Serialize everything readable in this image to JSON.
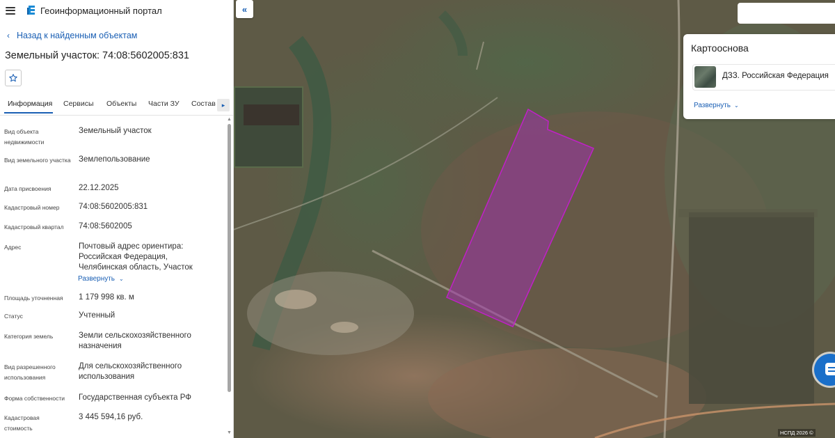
{
  "header": {
    "title": "Геоинформационный портал"
  },
  "nav": {
    "back_label": "Назад к найденным объектам"
  },
  "object": {
    "title": "Земельный участок: 74:08:5602005:831"
  },
  "tabs": [
    {
      "label": "Информация",
      "active": true
    },
    {
      "label": "Сервисы"
    },
    {
      "label": "Объекты"
    },
    {
      "label": "Части ЗУ"
    },
    {
      "label": "Состав"
    }
  ],
  "fields": [
    {
      "label": "Вид объекта недвижимости",
      "value": "Земельный участок"
    },
    {
      "label": "Вид земельного участка",
      "value": "Землепользование"
    },
    {
      "label": "Дата присвоения",
      "value": "22.12.2025"
    },
    {
      "label": "Кадастровый номер",
      "value": "74:08:5602005:831"
    },
    {
      "label": "Кадастровый квартал",
      "value": "74:08:5602005"
    },
    {
      "label": "Адрес",
      "value": "Почтовый адрес ориентира: Российская Федерация, Челябинская область, Участок"
    },
    {
      "label": "Площадь уточненная",
      "value": "1 179 998 кв. м"
    },
    {
      "label": "Статус",
      "value": "Учтенный"
    },
    {
      "label": "Категория земель",
      "value": "Земли сельскохозяйственного назначения"
    },
    {
      "label": "Вид разрешенного использования",
      "value": "Для сельскохозяйственного использования"
    },
    {
      "label": "Форма собственности",
      "value": "Государственная субъекта РФ"
    },
    {
      "label": "Кадастровая стоимость",
      "value": "3 445 594,16 руб."
    }
  ],
  "address_expand_label": "Развернуть",
  "basemap": {
    "title": "Картооснова",
    "layer_name": "ДЗЗ. Российская Федерация",
    "expand_label": "Развернуть"
  },
  "map": {
    "copyright": "НСПД 2026 ©"
  },
  "colors": {
    "accent": "#1a5fb4",
    "parcel_outline": "#c020c8",
    "parcel_fill": "#a030b0"
  }
}
